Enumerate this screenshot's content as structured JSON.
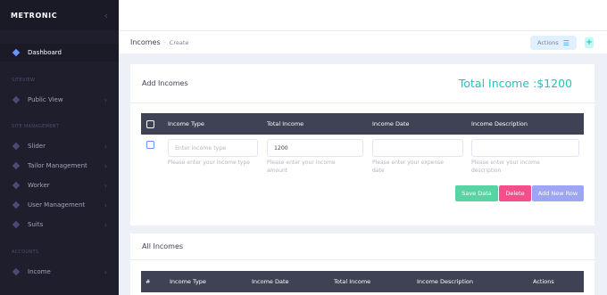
{
  "brand": {
    "name": "METRONIC",
    "toggle_icon": "chevron-left-icon"
  },
  "sidebar": {
    "dashboard": "Dashboard",
    "sections": {
      "siteview": "SITEVIEW",
      "site_management": "SITE MANAGEMENT",
      "accounts": "ACCOUNTS"
    },
    "items": {
      "public_view": "Public View",
      "slider": "Slider",
      "tailor_management": "Tailor Management",
      "worker": "Worker",
      "user_management": "User Management",
      "suits": "Suits",
      "income": "Income"
    },
    "arrow": "›"
  },
  "subheader": {
    "title": "Incomes",
    "sep": "-",
    "sub": "Create",
    "actions": "Actions",
    "actions_icon": "☰",
    "plus": "+"
  },
  "add_card": {
    "title": "Add Incomes",
    "total": "Total Income :$1200",
    "headers": {
      "type": "Income Type",
      "total": "Total Income",
      "date": "Income Date",
      "desc": "Income Description"
    },
    "row": {
      "type_placeholder": "Enter income type",
      "total_value": "1200",
      "date_value": "",
      "desc_value": ""
    },
    "help": {
      "type": "Please enter your income type",
      "total_l1": "Please enter your income",
      "total_l2": "amount",
      "date_l1": "Please enter your expense",
      "date_l2": "date",
      "desc_l1": "Please enter your income",
      "desc_l2": "description"
    },
    "buttons": {
      "save": "Save Data",
      "delete": "Delete",
      "add_row": "Add New Row"
    }
  },
  "all_card": {
    "title": "All Incomes",
    "headers": {
      "num": "#",
      "type": "Income Type",
      "date": "Income Date",
      "total": "Total Income",
      "desc": "Income Description",
      "actions": "Actions"
    }
  },
  "colors": {
    "sidebar_bg": "#1e1e2d",
    "accent_teal": "#1bc5bd",
    "accent_blue": "#6993ff",
    "table_head": "#3f4254"
  }
}
